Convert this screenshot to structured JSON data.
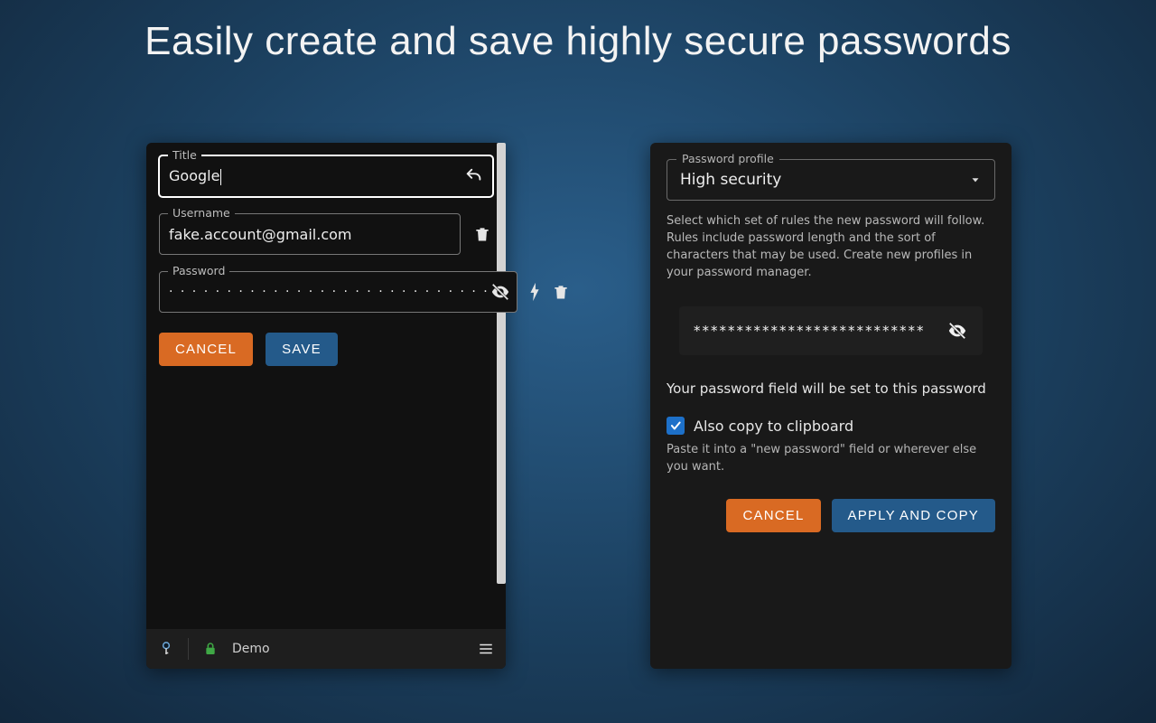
{
  "headline": "Easily create and save highly secure passwords",
  "left": {
    "title": {
      "label": "Title",
      "value": "Google"
    },
    "username": {
      "label": "Username",
      "value": "fake.account@gmail.com"
    },
    "password": {
      "label": "Password",
      "masked": "· · · · · · · · · · · · · · · · · · · · · · · · · · · ·"
    },
    "cancel": "CANCEL",
    "save": "SAVE",
    "footer_name": "Demo"
  },
  "right": {
    "profile": {
      "label": "Password profile",
      "selected": "High security"
    },
    "help": "Select which set of rules the new password will follow. Rules include password length and the sort of characters that may be used. Create new profiles in your password manager.",
    "preview_masked": "***************************",
    "set_note": "Your password field will be set to this password",
    "copy_checkbox": "Also copy to clipboard",
    "paste_note": "Paste it into a \"new password\" field or wherever else you want.",
    "cancel": "CANCEL",
    "apply": "APPLY AND COPY"
  }
}
